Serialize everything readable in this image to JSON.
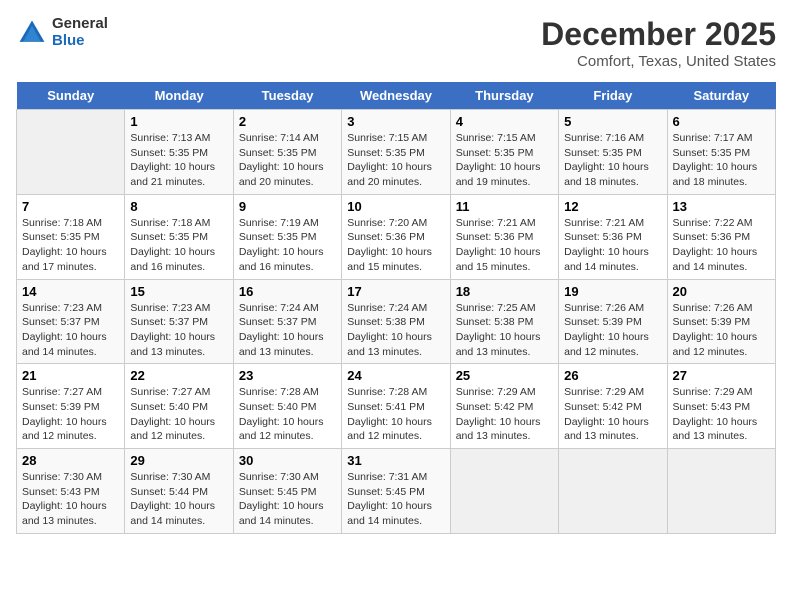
{
  "logo": {
    "general": "General",
    "blue": "Blue"
  },
  "title": "December 2025",
  "subtitle": "Comfort, Texas, United States",
  "days_of_week": [
    "Sunday",
    "Monday",
    "Tuesday",
    "Wednesday",
    "Thursday",
    "Friday",
    "Saturday"
  ],
  "weeks": [
    [
      {
        "day": "",
        "sunrise": "",
        "sunset": "",
        "daylight": "",
        "empty": true
      },
      {
        "day": "1",
        "sunrise": "Sunrise: 7:13 AM",
        "sunset": "Sunset: 5:35 PM",
        "daylight": "Daylight: 10 hours and 21 minutes."
      },
      {
        "day": "2",
        "sunrise": "Sunrise: 7:14 AM",
        "sunset": "Sunset: 5:35 PM",
        "daylight": "Daylight: 10 hours and 20 minutes."
      },
      {
        "day": "3",
        "sunrise": "Sunrise: 7:15 AM",
        "sunset": "Sunset: 5:35 PM",
        "daylight": "Daylight: 10 hours and 20 minutes."
      },
      {
        "day": "4",
        "sunrise": "Sunrise: 7:15 AM",
        "sunset": "Sunset: 5:35 PM",
        "daylight": "Daylight: 10 hours and 19 minutes."
      },
      {
        "day": "5",
        "sunrise": "Sunrise: 7:16 AM",
        "sunset": "Sunset: 5:35 PM",
        "daylight": "Daylight: 10 hours and 18 minutes."
      },
      {
        "day": "6",
        "sunrise": "Sunrise: 7:17 AM",
        "sunset": "Sunset: 5:35 PM",
        "daylight": "Daylight: 10 hours and 18 minutes."
      }
    ],
    [
      {
        "day": "7",
        "sunrise": "Sunrise: 7:18 AM",
        "sunset": "Sunset: 5:35 PM",
        "daylight": "Daylight: 10 hours and 17 minutes."
      },
      {
        "day": "8",
        "sunrise": "Sunrise: 7:18 AM",
        "sunset": "Sunset: 5:35 PM",
        "daylight": "Daylight: 10 hours and 16 minutes."
      },
      {
        "day": "9",
        "sunrise": "Sunrise: 7:19 AM",
        "sunset": "Sunset: 5:35 PM",
        "daylight": "Daylight: 10 hours and 16 minutes."
      },
      {
        "day": "10",
        "sunrise": "Sunrise: 7:20 AM",
        "sunset": "Sunset: 5:36 PM",
        "daylight": "Daylight: 10 hours and 15 minutes."
      },
      {
        "day": "11",
        "sunrise": "Sunrise: 7:21 AM",
        "sunset": "Sunset: 5:36 PM",
        "daylight": "Daylight: 10 hours and 15 minutes."
      },
      {
        "day": "12",
        "sunrise": "Sunrise: 7:21 AM",
        "sunset": "Sunset: 5:36 PM",
        "daylight": "Daylight: 10 hours and 14 minutes."
      },
      {
        "day": "13",
        "sunrise": "Sunrise: 7:22 AM",
        "sunset": "Sunset: 5:36 PM",
        "daylight": "Daylight: 10 hours and 14 minutes."
      }
    ],
    [
      {
        "day": "14",
        "sunrise": "Sunrise: 7:23 AM",
        "sunset": "Sunset: 5:37 PM",
        "daylight": "Daylight: 10 hours and 14 minutes."
      },
      {
        "day": "15",
        "sunrise": "Sunrise: 7:23 AM",
        "sunset": "Sunset: 5:37 PM",
        "daylight": "Daylight: 10 hours and 13 minutes."
      },
      {
        "day": "16",
        "sunrise": "Sunrise: 7:24 AM",
        "sunset": "Sunset: 5:37 PM",
        "daylight": "Daylight: 10 hours and 13 minutes."
      },
      {
        "day": "17",
        "sunrise": "Sunrise: 7:24 AM",
        "sunset": "Sunset: 5:38 PM",
        "daylight": "Daylight: 10 hours and 13 minutes."
      },
      {
        "day": "18",
        "sunrise": "Sunrise: 7:25 AM",
        "sunset": "Sunset: 5:38 PM",
        "daylight": "Daylight: 10 hours and 13 minutes."
      },
      {
        "day": "19",
        "sunrise": "Sunrise: 7:26 AM",
        "sunset": "Sunset: 5:39 PM",
        "daylight": "Daylight: 10 hours and 12 minutes."
      },
      {
        "day": "20",
        "sunrise": "Sunrise: 7:26 AM",
        "sunset": "Sunset: 5:39 PM",
        "daylight": "Daylight: 10 hours and 12 minutes."
      }
    ],
    [
      {
        "day": "21",
        "sunrise": "Sunrise: 7:27 AM",
        "sunset": "Sunset: 5:39 PM",
        "daylight": "Daylight: 10 hours and 12 minutes."
      },
      {
        "day": "22",
        "sunrise": "Sunrise: 7:27 AM",
        "sunset": "Sunset: 5:40 PM",
        "daylight": "Daylight: 10 hours and 12 minutes."
      },
      {
        "day": "23",
        "sunrise": "Sunrise: 7:28 AM",
        "sunset": "Sunset: 5:40 PM",
        "daylight": "Daylight: 10 hours and 12 minutes."
      },
      {
        "day": "24",
        "sunrise": "Sunrise: 7:28 AM",
        "sunset": "Sunset: 5:41 PM",
        "daylight": "Daylight: 10 hours and 12 minutes."
      },
      {
        "day": "25",
        "sunrise": "Sunrise: 7:29 AM",
        "sunset": "Sunset: 5:42 PM",
        "daylight": "Daylight: 10 hours and 13 minutes."
      },
      {
        "day": "26",
        "sunrise": "Sunrise: 7:29 AM",
        "sunset": "Sunset: 5:42 PM",
        "daylight": "Daylight: 10 hours and 13 minutes."
      },
      {
        "day": "27",
        "sunrise": "Sunrise: 7:29 AM",
        "sunset": "Sunset: 5:43 PM",
        "daylight": "Daylight: 10 hours and 13 minutes."
      }
    ],
    [
      {
        "day": "28",
        "sunrise": "Sunrise: 7:30 AM",
        "sunset": "Sunset: 5:43 PM",
        "daylight": "Daylight: 10 hours and 13 minutes."
      },
      {
        "day": "29",
        "sunrise": "Sunrise: 7:30 AM",
        "sunset": "Sunset: 5:44 PM",
        "daylight": "Daylight: 10 hours and 14 minutes."
      },
      {
        "day": "30",
        "sunrise": "Sunrise: 7:30 AM",
        "sunset": "Sunset: 5:45 PM",
        "daylight": "Daylight: 10 hours and 14 minutes."
      },
      {
        "day": "31",
        "sunrise": "Sunrise: 7:31 AM",
        "sunset": "Sunset: 5:45 PM",
        "daylight": "Daylight: 10 hours and 14 minutes."
      },
      {
        "day": "",
        "sunrise": "",
        "sunset": "",
        "daylight": "",
        "empty": true
      },
      {
        "day": "",
        "sunrise": "",
        "sunset": "",
        "daylight": "",
        "empty": true
      },
      {
        "day": "",
        "sunrise": "",
        "sunset": "",
        "daylight": "",
        "empty": true
      }
    ]
  ]
}
